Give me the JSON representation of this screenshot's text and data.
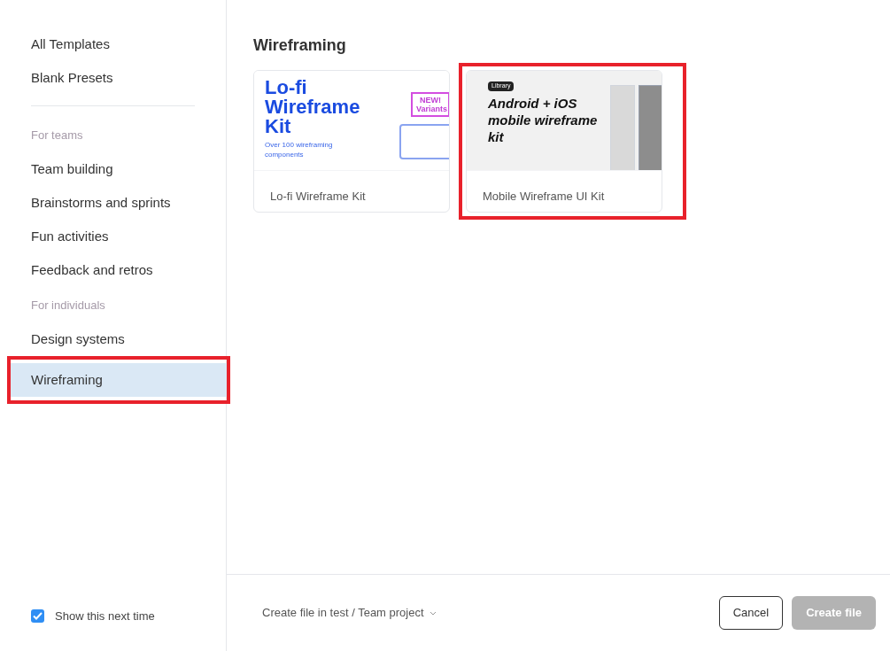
{
  "sidebar": {
    "items": [
      {
        "kind": "item",
        "label": "All Templates",
        "selected": false,
        "highlighted": false
      },
      {
        "kind": "item",
        "label": "Blank Presets",
        "selected": false,
        "highlighted": false
      },
      {
        "kind": "divider"
      },
      {
        "kind": "heading",
        "label": "For teams"
      },
      {
        "kind": "item",
        "label": "Team building",
        "selected": false,
        "highlighted": false
      },
      {
        "kind": "item",
        "label": "Brainstorms and sprints",
        "selected": false,
        "highlighted": false
      },
      {
        "kind": "item",
        "label": "Fun activities",
        "selected": false,
        "highlighted": false
      },
      {
        "kind": "item",
        "label": "Feedback and retros",
        "selected": false,
        "highlighted": false
      },
      {
        "kind": "heading",
        "label": "For individuals"
      },
      {
        "kind": "item",
        "label": "Design systems",
        "selected": false,
        "highlighted": false
      },
      {
        "kind": "item",
        "label": "Wireframing",
        "selected": true,
        "highlighted": true
      }
    ],
    "show_next_time": {
      "label": "Show this next time",
      "checked": true
    }
  },
  "main": {
    "title": "Wireframing",
    "templates": [
      {
        "kind": "lofi",
        "name": "Lo-fi Wireframe Kit",
        "highlighted": false,
        "thumbnail": {
          "title": "Lo-fi Wireframe Kit",
          "subtitle": "Over 100 wireframing components",
          "badge": "NEW! Variants"
        }
      },
      {
        "kind": "mobile",
        "name": "Mobile Wireframe UI Kit",
        "highlighted": true,
        "thumbnail": {
          "tag": "Library",
          "title": "Android + iOS mobile wireframe kit"
        }
      }
    ]
  },
  "footer": {
    "location": "Create file in test / Team project",
    "cancel": "Cancel",
    "create": {
      "label": "Create file",
      "disabled": true
    }
  }
}
